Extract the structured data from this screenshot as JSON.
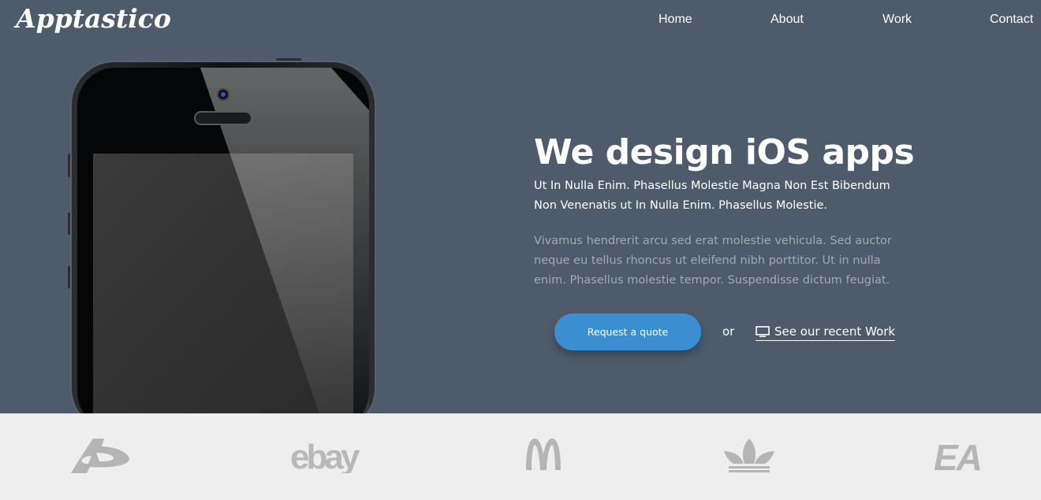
{
  "brand": {
    "logo_text": "Apptastico"
  },
  "nav": {
    "items": [
      {
        "label": "Home"
      },
      {
        "label": "About"
      },
      {
        "label": "Work"
      },
      {
        "label": "Contact"
      }
    ]
  },
  "hero": {
    "headline": "We design iOS apps",
    "lead": "Ut In Nulla Enim. Phasellus Molestie Magna Non Est Bibendum Non Venenatis ut In Nulla Enim. Phasellus Molestie.",
    "body": "Vivamus hendrerit arcu sed erat molestie vehicula. Sed auctor neque eu tellus rhoncus ut eleifend nibh porttitor. Ut in nulla enim. Phasellus molestie tempor. Suspendisse dictum feugiat.",
    "cta_label": "Request a quote",
    "or_text": "or",
    "work_link_label": "See our recent Work"
  },
  "clients": {
    "logos": [
      {
        "name": "deviantart-logo",
        "text": ""
      },
      {
        "name": "ebay-logo",
        "text": "ebay"
      },
      {
        "name": "mcdonalds-logo",
        "text": ""
      },
      {
        "name": "adidas-logo",
        "text": ""
      },
      {
        "name": "ea-logo",
        "text": "EA"
      }
    ]
  },
  "colors": {
    "hero_bg": "#4d5b6a",
    "accent": "#3b8fd1",
    "muted_text": "#a2a9b1",
    "strip_bg": "#eeeeee",
    "logo_gray": "#b5b5b5"
  }
}
